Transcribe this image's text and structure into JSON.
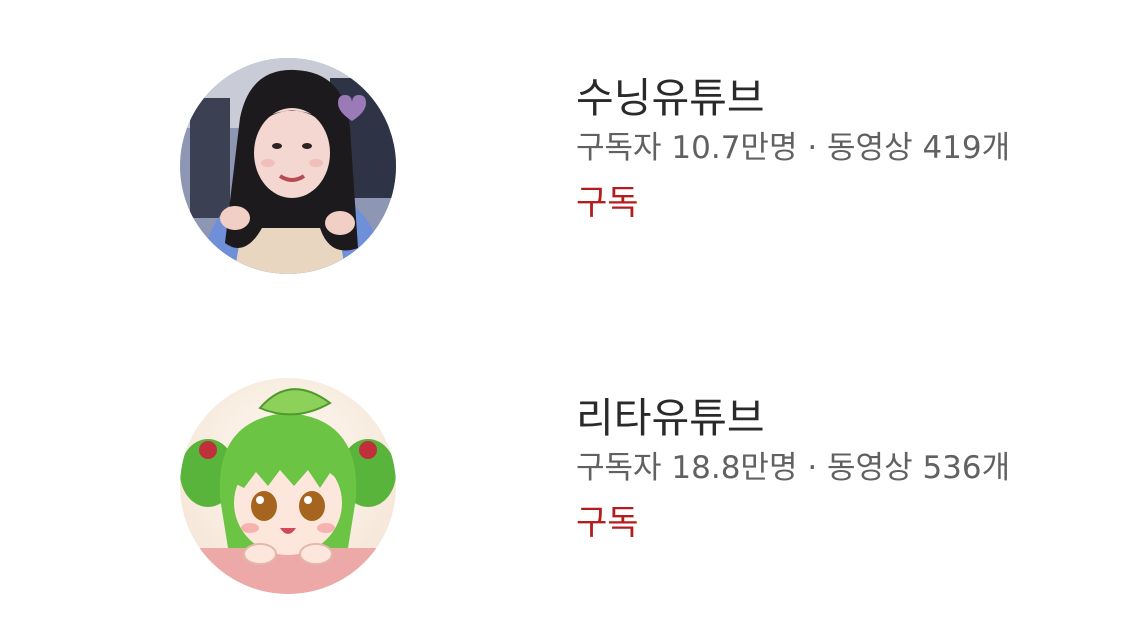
{
  "channels": [
    {
      "name": "수닝유튜브",
      "stats": "구독자 10.7만명 · 동영상 419개",
      "subscribe_label": "구독",
      "avatar_icon": "channel-avatar-photo"
    },
    {
      "name": "리타유튜브",
      "stats": "구독자 18.8만명 · 동영상 536개",
      "subscribe_label": "구독",
      "avatar_icon": "channel-avatar-illustration"
    }
  ],
  "colors": {
    "subscribe": "#b51d1d",
    "name": "#2a2a2a",
    "meta": "#616161"
  }
}
